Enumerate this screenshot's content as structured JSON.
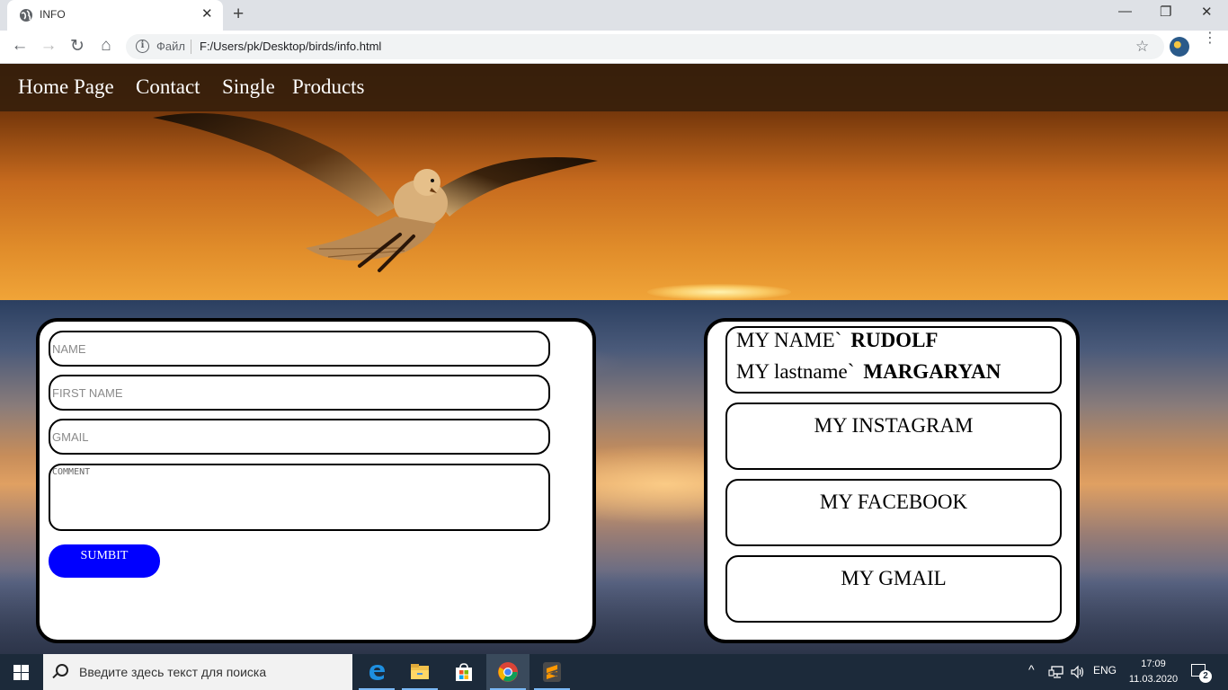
{
  "browser": {
    "tab_title": "INFO",
    "tab_close": "✕",
    "new_tab": "+",
    "window_controls": {
      "minimize": "—",
      "restore": "❐",
      "close": "✕"
    },
    "nav": {
      "back": "←",
      "forward": "→",
      "reload": "↻",
      "home": "⌂"
    },
    "info_icon": "i",
    "file_label": "Файл",
    "url": "F:/Users/pk/Desktop/birds/info.html",
    "bookmark_icon": "☆",
    "menu_icon": "⋮"
  },
  "navbar": {
    "links": [
      "Home Page",
      "Contact",
      "Single",
      "Products"
    ]
  },
  "form": {
    "name_placeholder": "NAME",
    "first_name_placeholder": "FIRST NAME",
    "gmail_placeholder": "GMAIL",
    "comment_placeholder": "COMMENT",
    "submit_label": "SUMBIT"
  },
  "info": {
    "name_label": "MY NAME`",
    "name_value": "RUDOLF",
    "lastname_label": "MY lastname`",
    "lastname_value": "MARGARYAN",
    "instagram": "MY INSTAGRAM",
    "facebook": "MY FACEBOOK",
    "gmail": "MY GMAIL"
  },
  "taskbar": {
    "search_placeholder": "Введите здесь текст для поиска",
    "language": "ENG",
    "time": "17:09",
    "date": "11.03.2020",
    "notifications": "2",
    "apps": [
      "edge-icon",
      "file-explorer-icon",
      "store-icon",
      "chrome-icon",
      "sublime-text-icon"
    ],
    "accent_color": "#7ab8f5"
  },
  "colors": {
    "navbar_bg": "#37200c",
    "submit_bg": "#0000ff",
    "taskbar_bg": "#1c2a3a"
  }
}
